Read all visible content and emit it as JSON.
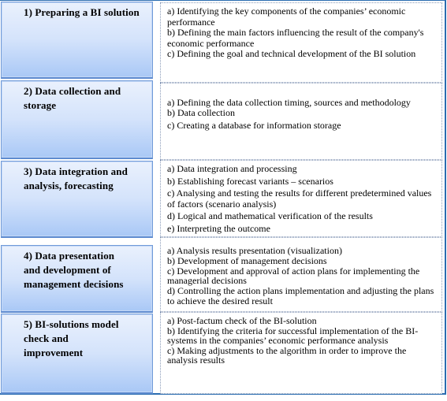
{
  "stages": [
    {
      "title": "1) Preparing a BI solution",
      "items": [
        "a) Identifying the key components of the companies’ economic performance",
        "b) Defining the main factors influencing the result of the company's economic performance",
        "c) Defining the goal and technical development of the BI solution"
      ]
    },
    {
      "title": "2) Data collection and storage",
      "items": [
        "a) Defining the data collection timing, sources and methodology",
        "b) Data collection",
        "c) Creating a database for information storage"
      ]
    },
    {
      "title": "3) Data integration and analysis, forecasting",
      "items": [
        "a) Data integration and processing",
        "b) Establishing forecast variants – scenarios",
        "c) Analysing and testing the results for different predetermined values of factors (scenario analysis)",
        "d) Logical and mathematical verification of the results",
        "e) Interpreting the outcome"
      ]
    },
    {
      "title": "4) Data presentation and development of management decisions",
      "items": [
        "a) Analysis results presentation (visualization)",
        "b) Development of management decisions",
        "c) Development and approval of action plans for implementing the managerial decisions",
        "d) Controlling the action plans implementation and adjusting the plans to achieve the desired result"
      ]
    },
    {
      "title": "5) BI-solutions model check and improvement",
      "items": [
        "a) Post-factum check of the BI-solution",
        "b) Identifying the criteria for successful implementation of the BI-systems in the companies’ economic performance analysis",
        "c) Making adjustments to the algorithm in order to improve the analysis results"
      ]
    }
  ],
  "colors": {
    "stage_gradient_top": "#eaf1fd",
    "stage_gradient_bottom": "#a9c8f6",
    "frame_border": "#2a6cb0",
    "detail_border": "#8a9bb8"
  }
}
